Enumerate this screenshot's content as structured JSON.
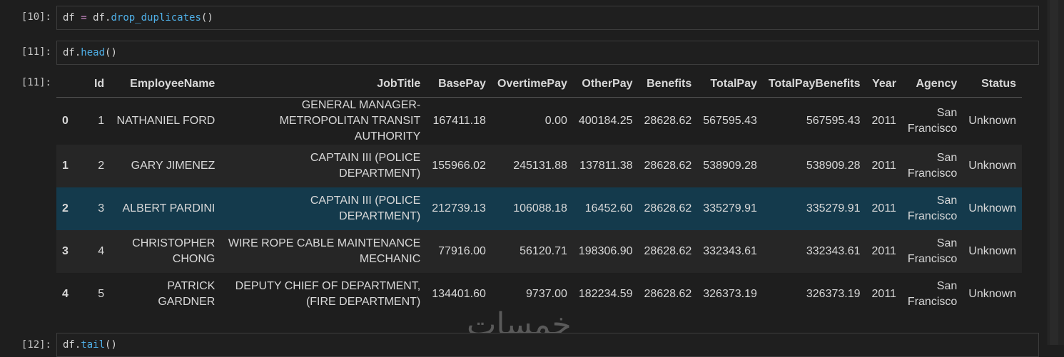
{
  "cells": [
    {
      "label": "[10]:",
      "code": {
        "var": "df",
        "op": "=",
        "obj": "df.",
        "fn": "drop_duplicates",
        "rest": "()"
      }
    },
    {
      "label": "[11]:",
      "code": {
        "obj": "df.",
        "fn": "head",
        "rest": "()"
      }
    },
    {
      "label": "[12]:",
      "code": {
        "obj": "df.",
        "fn": "tail",
        "rest": "()"
      }
    }
  ],
  "output_label": "[11]:",
  "table": {
    "headers": [
      "",
      "Id",
      "EmployeeName",
      "JobTitle",
      "BasePay",
      "OvertimePay",
      "OtherPay",
      "Benefits",
      "TotalPay",
      "TotalPayBenefits",
      "Year",
      "Agency",
      "Status"
    ],
    "rows": [
      [
        "0",
        "1",
        "NATHANIEL FORD",
        "GENERAL MANAGER-METROPOLITAN TRANSIT AUTHORITY",
        "167411.18",
        "0.00",
        "400184.25",
        "28628.62",
        "567595.43",
        "567595.43",
        "2011",
        "San Francisco",
        "Unknown"
      ],
      [
        "1",
        "2",
        "GARY JIMENEZ",
        "CAPTAIN III (POLICE DEPARTMENT)",
        "155966.02",
        "245131.88",
        "137811.38",
        "28628.62",
        "538909.28",
        "538909.28",
        "2011",
        "San Francisco",
        "Unknown"
      ],
      [
        "2",
        "3",
        "ALBERT PARDINI",
        "CAPTAIN III (POLICE DEPARTMENT)",
        "212739.13",
        "106088.18",
        "16452.60",
        "28628.62",
        "335279.91",
        "335279.91",
        "2011",
        "San Francisco",
        "Unknown"
      ],
      [
        "3",
        "4",
        "CHRISTOPHER CHONG",
        "WIRE ROPE CABLE MAINTENANCE MECHANIC",
        "77916.00",
        "56120.71",
        "198306.90",
        "28628.62",
        "332343.61",
        "332343.61",
        "2011",
        "San Francisco",
        "Unknown"
      ],
      [
        "4",
        "5",
        "PATRICK GARDNER",
        "DEPUTY CHIEF OF DEPARTMENT,(FIRE DEPARTMENT)",
        "134401.60",
        "9737.00",
        "182234.59",
        "28628.62",
        "326373.19",
        "326373.19",
        "2011",
        "San Francisco",
        "Unknown"
      ]
    ]
  },
  "watermark": "خمسات"
}
